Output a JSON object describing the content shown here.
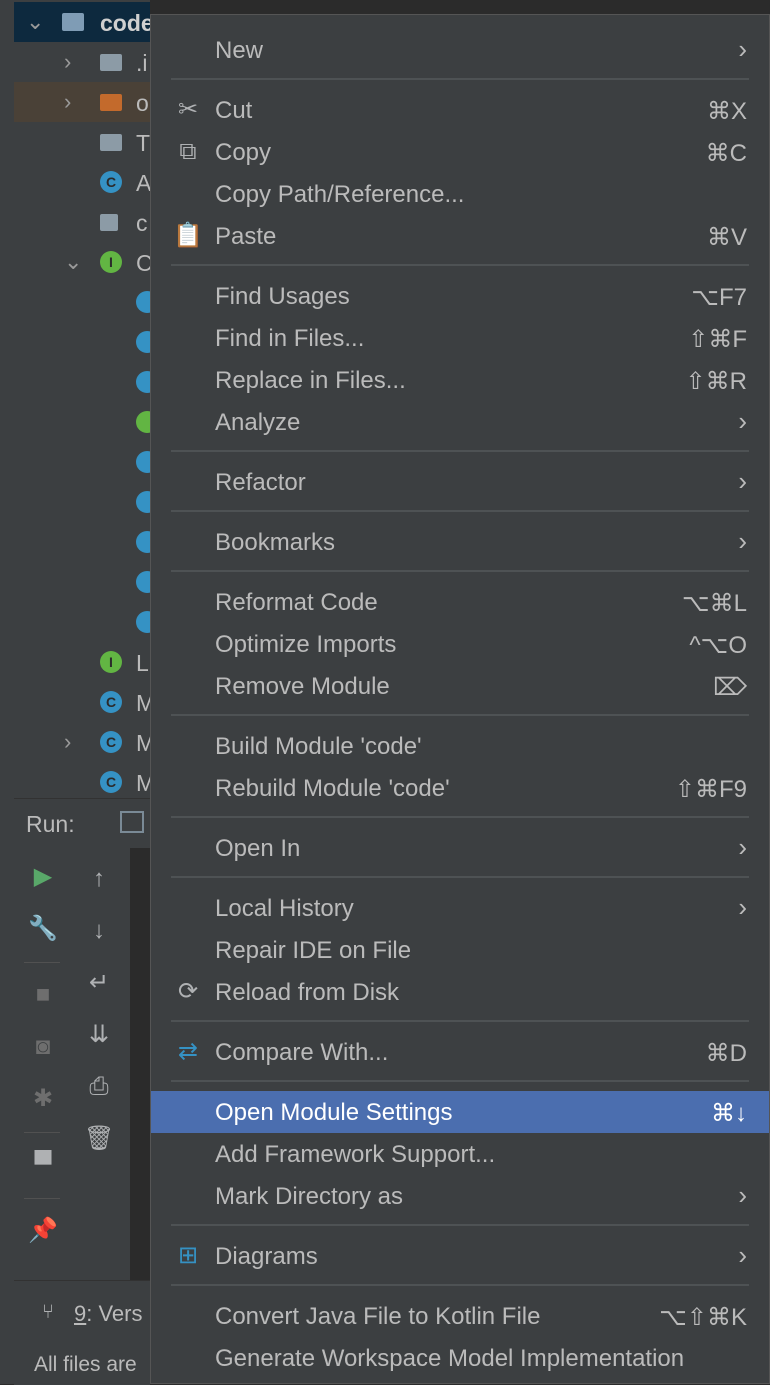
{
  "project_tree": {
    "root_label": "code",
    "rows": [
      {
        "label": ".i"
      },
      {
        "label": "o"
      },
      {
        "label": "T"
      },
      {
        "label": "A"
      },
      {
        "label": "c"
      },
      {
        "label": "C"
      },
      {
        "label": "L"
      },
      {
        "label": "M"
      },
      {
        "label": "M"
      },
      {
        "label": "M"
      }
    ],
    "class_icon_letter": "C",
    "interface_icon_letter": "I"
  },
  "run_panel": {
    "label": "Run:"
  },
  "status": {
    "vcs_tab_number": "9",
    "vcs_tab_label": ": Vers",
    "text": "All files are"
  },
  "context_menu": {
    "items": [
      {
        "label": "New",
        "shortcut": "",
        "submenu": true
      },
      {
        "label": "Cut",
        "shortcut": "⌘X"
      },
      {
        "label": "Copy",
        "shortcut": "⌘C"
      },
      {
        "label": "Copy Path/Reference...",
        "shortcut": ""
      },
      {
        "label": "Paste",
        "shortcut": "⌘V"
      },
      {
        "label": "Find Usages",
        "shortcut": "⌥F7"
      },
      {
        "label": "Find in Files...",
        "shortcut": "⇧⌘F"
      },
      {
        "label": "Replace in Files...",
        "shortcut": "⇧⌘R"
      },
      {
        "label": "Analyze",
        "shortcut": "",
        "submenu": true
      },
      {
        "label": "Refactor",
        "shortcut": "",
        "submenu": true
      },
      {
        "label": "Bookmarks",
        "shortcut": "",
        "submenu": true
      },
      {
        "label": "Reformat Code",
        "shortcut": "⌥⌘L"
      },
      {
        "label": "Optimize Imports",
        "shortcut": "^⌥O"
      },
      {
        "label": "Remove Module",
        "shortcut": "⌦"
      },
      {
        "label": "Build Module 'code'",
        "shortcut": ""
      },
      {
        "label": "Rebuild Module 'code'",
        "shortcut": "⇧⌘F9"
      },
      {
        "label": "Open In",
        "shortcut": "",
        "submenu": true
      },
      {
        "label": "Local History",
        "shortcut": "",
        "submenu": true
      },
      {
        "label": "Repair IDE on File",
        "shortcut": ""
      },
      {
        "label": "Reload from Disk",
        "shortcut": ""
      },
      {
        "label": "Compare With...",
        "shortcut": "⌘D"
      },
      {
        "label": "Open Module Settings",
        "shortcut": "⌘↓",
        "selected": true
      },
      {
        "label": "Add Framework Support...",
        "shortcut": ""
      },
      {
        "label": "Mark Directory as",
        "shortcut": "",
        "submenu": true
      },
      {
        "label": "Diagrams",
        "shortcut": "",
        "submenu": true
      },
      {
        "label": "Convert Java File to Kotlin File",
        "shortcut": "⌥⇧⌘K"
      },
      {
        "label": "Generate Workspace Model Implementation",
        "shortcut": ""
      }
    ],
    "submenu_arrow_glyph": "›",
    "icons": {
      "cut": "scissors-icon",
      "copy": "copy-icon",
      "paste": "clipboard-icon",
      "reload": "reload-icon",
      "compare": "compare-icon",
      "diagrams": "diagram-icon"
    }
  },
  "colors": {
    "menu_background": "#3c3f41",
    "selection": "#4b6eaf",
    "text": "#bbbbbb"
  }
}
